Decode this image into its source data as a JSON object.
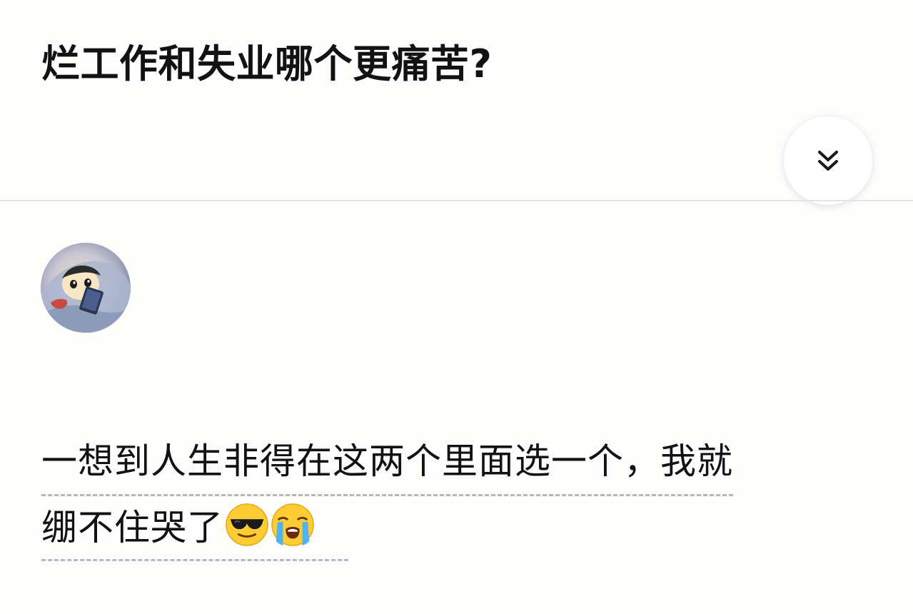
{
  "question": {
    "title": "烂工作和失业哪个更痛苦?"
  },
  "answer": {
    "line1": "一想到人生非得在这两个里面选一个，我就",
    "line2": "绷不住哭了",
    "emojis": [
      "sunglasses-emoji",
      "loudly-crying-emoji"
    ]
  },
  "icons": {
    "expand": "chevron-double-down-icon",
    "avatar": "user-avatar"
  }
}
